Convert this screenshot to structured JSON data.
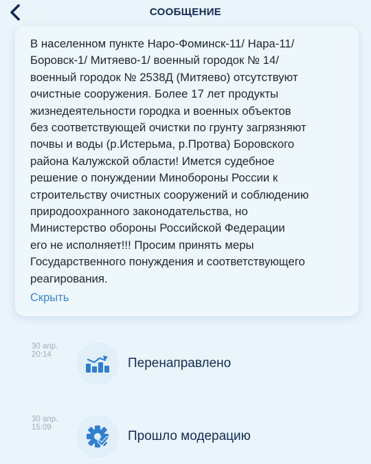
{
  "header": {
    "title": "СООБЩЕНИЕ"
  },
  "message": {
    "text": "В населенном пункте Наро-Фоминск-11/ Нара-11/\nБоровск-1/ Митяево-1/ военный городок № 14/\nвоенный городок № 2538Д (Митяево) отсутствуют\nочистные сооружения. Более 17 лет продукты\nжизнедеятельности городка и военных объектов\nбез соответствующей очистки по грунту загрязняют\nпочвы и воды (р.Истерьма, р.Протва) Боровского\nрайона Калужской области! Имется судебное\nрешение о понуждении Минобороны России к\nстроительству очистных сооружений и соблюдению\nприродоохранного законодательства, но\nМинистерство обороны Российской Федерации\nего не исполняет!!! Просим принять меры\nГосударственного понуждения и соответствующего\nреагирования.",
    "hide_link": "Скрыть"
  },
  "events": [
    {
      "date": "30 апр.",
      "time": "20:14",
      "label": "Перенаправлено",
      "icon": "redirect-icon"
    },
    {
      "date": "30 апр.",
      "time": "15:09",
      "label": "Прошло модерацию",
      "icon": "gear-check-icon"
    }
  ],
  "colors": {
    "accent": "#3a86d4",
    "title": "#142a52",
    "background": "#e9f4fb"
  }
}
